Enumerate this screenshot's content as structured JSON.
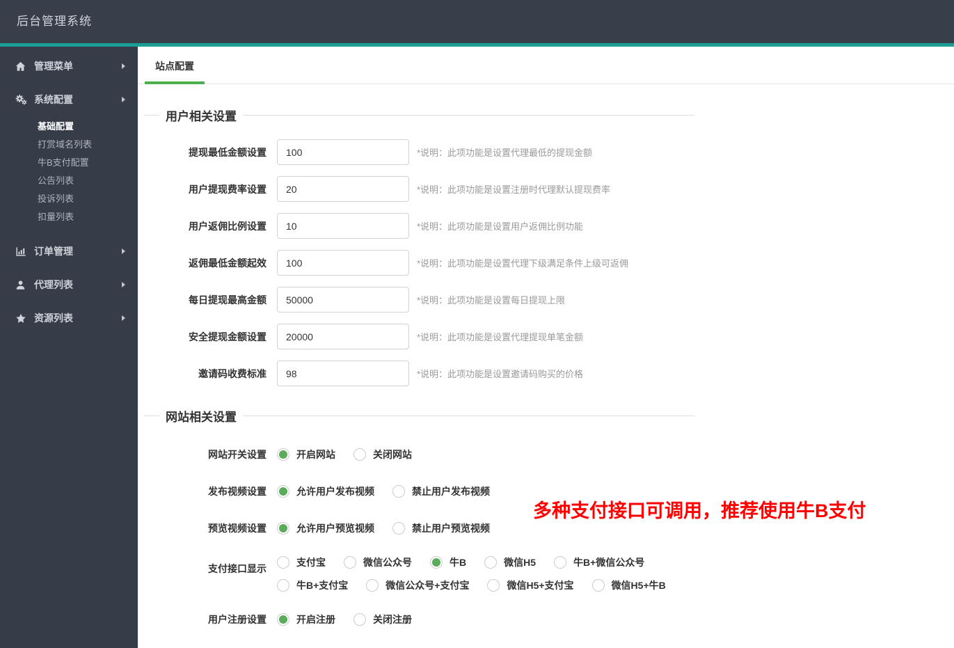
{
  "app": {
    "title": "后台管理系统"
  },
  "colors": {
    "header_bg": "#383e4a",
    "sidebar_bg": "#363c48",
    "accent_teal": "#1b9e94",
    "tab_underline_green": "#4cae4c",
    "radio_green": "#5aab5a",
    "annotation_red": "#ff0000"
  },
  "sidebar": {
    "items": [
      {
        "name": "admin-menu",
        "icon": "home-icon",
        "label": "管理菜单"
      },
      {
        "name": "system-config",
        "icon": "gears-icon",
        "label": "系统配置",
        "expanded": true,
        "children": [
          {
            "name": "basic-config",
            "label": "基础配置",
            "active": true
          },
          {
            "name": "reward-domain-list",
            "label": "打赏域名列表"
          },
          {
            "name": "niub-pay-config",
            "label": "牛B支付配置"
          },
          {
            "name": "notice-list",
            "label": "公告列表"
          },
          {
            "name": "complaint-list",
            "label": "投诉列表"
          },
          {
            "name": "deduction-list",
            "label": "扣量列表"
          }
        ]
      },
      {
        "name": "order-management",
        "icon": "bar-chart-icon",
        "label": "订单管理"
      },
      {
        "name": "agent-list",
        "icon": "user-icon",
        "label": "代理列表"
      },
      {
        "name": "resource-list",
        "icon": "star-icon",
        "label": "资源列表"
      }
    ]
  },
  "tabs": [
    {
      "label": "站点配置",
      "active": true
    }
  ],
  "sections": [
    {
      "title": "用户相关设置",
      "fields": [
        {
          "name": "min-withdraw-amount",
          "label": "提现最低金额设置",
          "value": "100",
          "note": "*说明：此项功能是设置代理最低的提现金额"
        },
        {
          "name": "withdraw-fee-rate",
          "label": "用户提现费率设置",
          "value": "20",
          "note": "*说明：此项功能是设置注册时代理默认提现费率"
        },
        {
          "name": "rebate-ratio",
          "label": "用户返佣比例设置",
          "value": "10",
          "note": "*说明：此项功能是设置用户返佣比例功能"
        },
        {
          "name": "rebate-min-amount",
          "label": "返佣最低金额起效",
          "value": "100",
          "note": "*说明：此项功能是设置代理下级满足条件上级可返佣"
        },
        {
          "name": "daily-withdraw-max",
          "label": "每日提现最高金额",
          "value": "50000",
          "note": "*说明：此项功能是设置每日提现上限"
        },
        {
          "name": "safe-withdraw-amount",
          "label": "安全提现金额设置",
          "value": "20000",
          "note": "*说明：此项功能是设置代理提现单笔金额"
        },
        {
          "name": "invite-code-price",
          "label": "邀请码收费标准",
          "value": "98",
          "note": "*说明：此项功能是设置邀请码购买的价格"
        }
      ]
    },
    {
      "title": "网站相关设置",
      "groups": [
        {
          "name": "site-switch",
          "label": "网站开关设置",
          "rows": [
            [
              {
                "label": "开启网站",
                "selected": true
              },
              {
                "label": "关闭网站",
                "selected": false
              }
            ]
          ]
        },
        {
          "name": "publish-video",
          "label": "发布视频设置",
          "rows": [
            [
              {
                "label": "允许用户发布视频",
                "selected": true
              },
              {
                "label": "禁止用户发布视频",
                "selected": false
              }
            ]
          ]
        },
        {
          "name": "preview-video",
          "label": "预览视频设置",
          "rows": [
            [
              {
                "label": "允许用户预览视频",
                "selected": true
              },
              {
                "label": "禁止用户预览视频",
                "selected": false
              }
            ]
          ]
        },
        {
          "name": "payment-interface",
          "label": "支付接口显示",
          "rows": [
            [
              {
                "label": "支付宝",
                "selected": false
              },
              {
                "label": "微信公众号",
                "selected": false
              },
              {
                "label": "牛B",
                "selected": true
              },
              {
                "label": "微信H5",
                "selected": false
              },
              {
                "label": "牛B+微信公众号",
                "selected": false
              }
            ],
            [
              {
                "label": "牛B+支付宝",
                "selected": false
              },
              {
                "label": "微信公众号+支付宝",
                "selected": false
              },
              {
                "label": "微信H5+支付宝",
                "selected": false
              },
              {
                "label": "微信H5+牛B",
                "selected": false
              }
            ]
          ]
        },
        {
          "name": "user-register",
          "label": "用户注册设置",
          "rows": [
            [
              {
                "label": "开启注册",
                "selected": true
              },
              {
                "label": "关闭注册",
                "selected": false
              }
            ]
          ]
        }
      ]
    }
  ],
  "annotation": {
    "text": "多种支付接口可调用，推荐使用牛B支付",
    "color": "#ff0000"
  }
}
